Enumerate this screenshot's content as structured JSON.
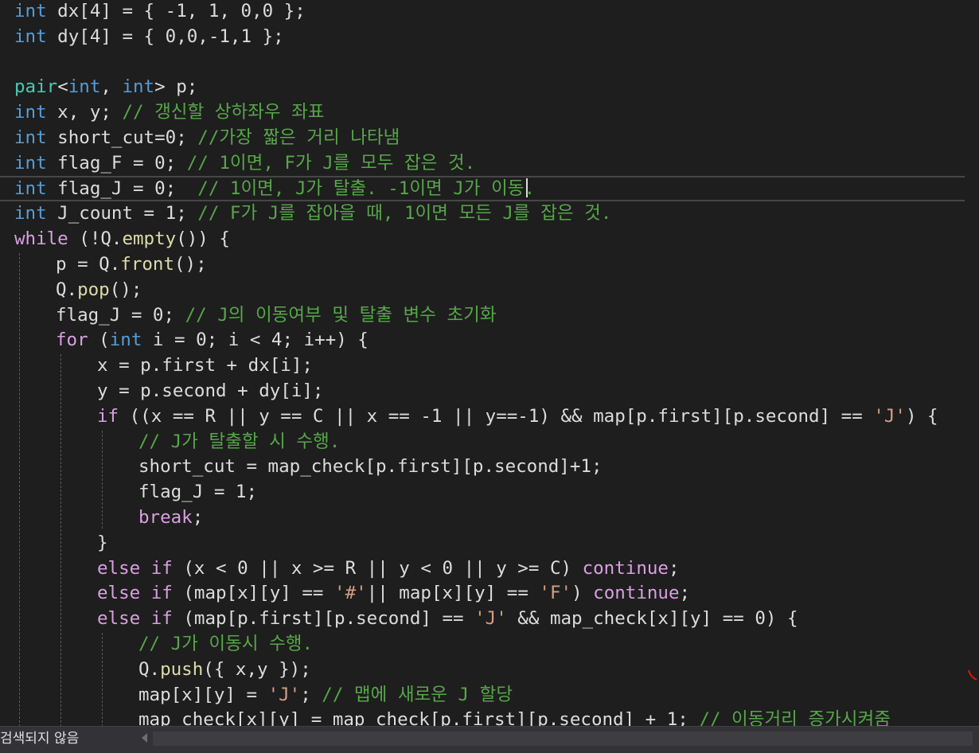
{
  "editor": {
    "colors": {
      "background": "#1e1e1e",
      "default": "#dcdcdc",
      "keyword": "#569cd6",
      "type": "#4ec9b0",
      "comment": "#57a64a",
      "string": "#d69d85",
      "number": "#b5cea8",
      "control": "#d8a0df",
      "function": "#dcdcaa",
      "member": "#dadada"
    },
    "current_line_index": 7,
    "lines": [
      {
        "indent": 0,
        "tokens": [
          [
            "int",
            "keyword"
          ],
          [
            " dx[4] = { -1, 1, 0,0 };",
            "default"
          ]
        ]
      },
      {
        "indent": 0,
        "tokens": [
          [
            "int",
            "keyword"
          ],
          [
            " dy[4] = { 0,0,-1,1 };",
            "default"
          ]
        ]
      },
      {
        "indent": 0,
        "tokens": []
      },
      {
        "indent": 0,
        "tokens": [
          [
            "pair",
            "type"
          ],
          [
            "<",
            "default"
          ],
          [
            "int",
            "keyword"
          ],
          [
            ", ",
            "default"
          ],
          [
            "int",
            "keyword"
          ],
          [
            "> p;",
            "default"
          ]
        ]
      },
      {
        "indent": 0,
        "tokens": [
          [
            "int",
            "keyword"
          ],
          [
            " x, y; ",
            "default"
          ],
          [
            "// 갱신할 상하좌우 좌표",
            "comment"
          ]
        ]
      },
      {
        "indent": 0,
        "tokens": [
          [
            "int",
            "keyword"
          ],
          [
            " short_cut=0; ",
            "default"
          ],
          [
            "//가장 짧은 거리 나타냄",
            "comment"
          ]
        ]
      },
      {
        "indent": 0,
        "tokens": [
          [
            "int",
            "keyword"
          ],
          [
            " flag_F = 0; ",
            "default"
          ],
          [
            "// 1이면, F가 J를 모두 잡은 것.",
            "comment"
          ]
        ]
      },
      {
        "indent": 0,
        "tokens": [
          [
            "int",
            "keyword"
          ],
          [
            " flag_J = 0;  ",
            "default"
          ],
          [
            "// 1이면, J가 탈출. -1이면 J가 이동.",
            "comment"
          ]
        ]
      },
      {
        "indent": 0,
        "tokens": [
          [
            "int",
            "keyword"
          ],
          [
            " J_count = 1; ",
            "default"
          ],
          [
            "// F가 J를 잡아을 때, 1이면 모든 J를 잡은 것.",
            "comment"
          ]
        ]
      },
      {
        "indent": 0,
        "tokens": [
          [
            "while",
            "control"
          ],
          [
            " (!Q.",
            "default"
          ],
          [
            "empty",
            "function"
          ],
          [
            "()) {",
            "default"
          ]
        ]
      },
      {
        "indent": 1,
        "tokens": [
          [
            "p = Q.",
            "default"
          ],
          [
            "front",
            "function"
          ],
          [
            "();",
            "default"
          ]
        ]
      },
      {
        "indent": 1,
        "tokens": [
          [
            "Q.",
            "default"
          ],
          [
            "pop",
            "function"
          ],
          [
            "();",
            "default"
          ]
        ]
      },
      {
        "indent": 1,
        "tokens": [
          [
            "flag_J = 0; ",
            "default"
          ],
          [
            "// J의 이동여부 및 탈출 변수 초기화",
            "comment"
          ]
        ]
      },
      {
        "indent": 1,
        "tokens": [
          [
            "for",
            "control"
          ],
          [
            " (",
            "default"
          ],
          [
            "int",
            "keyword"
          ],
          [
            " i = 0; i < 4; i++) {",
            "default"
          ]
        ]
      },
      {
        "indent": 2,
        "tokens": [
          [
            "x = p.first + dx[i];",
            "default"
          ]
        ]
      },
      {
        "indent": 2,
        "tokens": [
          [
            "y = p.second + dy[i];",
            "default"
          ]
        ]
      },
      {
        "indent": 2,
        "tokens": [
          [
            "if",
            "control"
          ],
          [
            " ((x == R || y == C || x == -1 || y==-1) && map[p.first][p.second] == ",
            "default"
          ],
          [
            "'J'",
            "string"
          ],
          [
            ") {",
            "default"
          ]
        ]
      },
      {
        "indent": 3,
        "tokens": [
          [
            "// J가 탈출할 시 수행.",
            "comment"
          ]
        ]
      },
      {
        "indent": 3,
        "tokens": [
          [
            "short_cut = map_check[p.first][p.second]+1;",
            "default"
          ]
        ]
      },
      {
        "indent": 3,
        "tokens": [
          [
            "flag_J = 1;",
            "default"
          ]
        ]
      },
      {
        "indent": 3,
        "tokens": [
          [
            "break",
            "control"
          ],
          [
            ";",
            "default"
          ]
        ]
      },
      {
        "indent": 2,
        "tokens": [
          [
            "}",
            "default"
          ]
        ]
      },
      {
        "indent": 2,
        "tokens": [
          [
            "else if",
            "control"
          ],
          [
            " (x < 0 || x >= R || y < 0 || y >= C) ",
            "default"
          ],
          [
            "continue",
            "control"
          ],
          [
            ";",
            "default"
          ]
        ]
      },
      {
        "indent": 2,
        "tokens": [
          [
            "else if",
            "control"
          ],
          [
            " (map[x][y] == ",
            "default"
          ],
          [
            "'#'",
            "string"
          ],
          [
            "|| map[x][y] == ",
            "default"
          ],
          [
            "'F'",
            "string"
          ],
          [
            ") ",
            "default"
          ],
          [
            "continue",
            "control"
          ],
          [
            ";",
            "default"
          ]
        ]
      },
      {
        "indent": 2,
        "tokens": [
          [
            "else if",
            "control"
          ],
          [
            " (map[p.first][p.second] == ",
            "default"
          ],
          [
            "'J'",
            "string"
          ],
          [
            " && map_check[x][y] == 0) {",
            "default"
          ]
        ]
      },
      {
        "indent": 3,
        "tokens": [
          [
            "// J가 이동시 수행.",
            "comment"
          ]
        ]
      },
      {
        "indent": 3,
        "tokens": [
          [
            "Q.",
            "default"
          ],
          [
            "push",
            "function"
          ],
          [
            "({ x,y });",
            "default"
          ]
        ]
      },
      {
        "indent": 3,
        "tokens": [
          [
            "map[x][y] = ",
            "default"
          ],
          [
            "'J'",
            "string"
          ],
          [
            "; ",
            "default"
          ],
          [
            "// 맵에 새로운 J 할당",
            "comment"
          ]
        ]
      },
      {
        "indent": 3,
        "tokens": [
          [
            "map_check[x][y] = map_check[p.first][p.second] + 1; ",
            "default"
          ],
          [
            "// 이동거리 증가시켜줌",
            "comment"
          ]
        ]
      }
    ]
  },
  "status_bar": {
    "search_status": "검색되지 않음"
  }
}
